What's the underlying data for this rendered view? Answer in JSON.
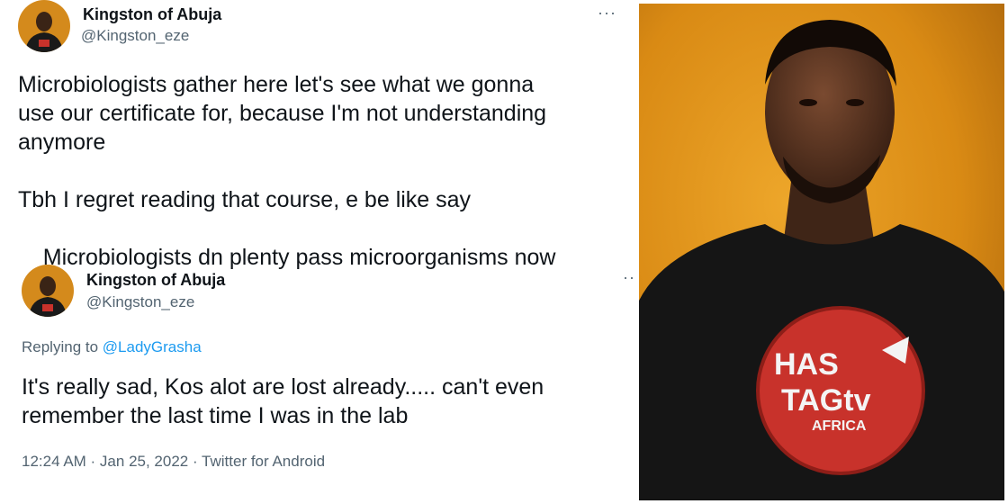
{
  "tweet1": {
    "display_name": "Kingston of Abuja",
    "handle": "@Kingston_eze",
    "more_label": "···",
    "text_line1": "Microbiologists gather here let's see what we gonna",
    "text_line2": "use our certificate for, because I'm not understanding",
    "text_line3": "anymore",
    "text_line4": "Tbh I regret reading that course, e be like say",
    "text_line5": "Microbiologists dn plenty pass microorganisms now",
    "emoji_icon": "rolling-on-floor-laughing-emoji"
  },
  "tweet2": {
    "display_name": "Kingston of Abuja",
    "handle": "@Kingston_eze",
    "more_label": "··",
    "replying_prefix": "Replying to ",
    "replying_handle": "@LadyGrasha",
    "text_line1": "It's really sad, Kos alot are lost already..... can't even",
    "text_line2": "remember the last time I was in the lab",
    "timestamp": "12:24 AM · Jan 25, 2022 · Twitter for Android"
  },
  "photo": {
    "shirt_text_line1": "HAS",
    "shirt_text_line2": "TAGtv",
    "shirt_text_line3": "AFRICA",
    "colors": {
      "background": "#d98a14",
      "shirt": "#151515",
      "logo_red": "#c8322b"
    }
  }
}
